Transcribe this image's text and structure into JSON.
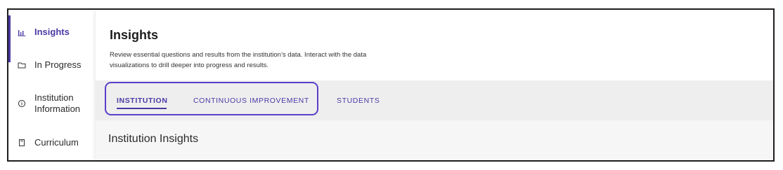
{
  "sidebar": {
    "items": [
      {
        "label": "Insights",
        "icon": "bar-chart-icon",
        "active": true
      },
      {
        "label": "In Progress",
        "icon": "folder-icon",
        "active": false
      },
      {
        "label": "Institution Information",
        "icon": "info-circle-icon",
        "active": false
      },
      {
        "label": "Curriculum",
        "icon": "book-icon",
        "active": false
      }
    ]
  },
  "header": {
    "title": "Insights",
    "description": "Review essential questions and results from the institution’s data. Interact with the data visualizations to drill deeper into progress and results."
  },
  "tabs": [
    {
      "label": "INSTITUTION",
      "active": true
    },
    {
      "label": "CONTINUOUS IMPROVEMENT",
      "active": false
    },
    {
      "label": "STUDENTS",
      "active": false
    }
  ],
  "content": {
    "section_title": "Institution Insights"
  },
  "colors": {
    "accent": "#4a3aa5",
    "highlight": "#5b3fc9",
    "tabbar_bg": "#eeeeee",
    "content_bg": "#f6f6f6"
  }
}
